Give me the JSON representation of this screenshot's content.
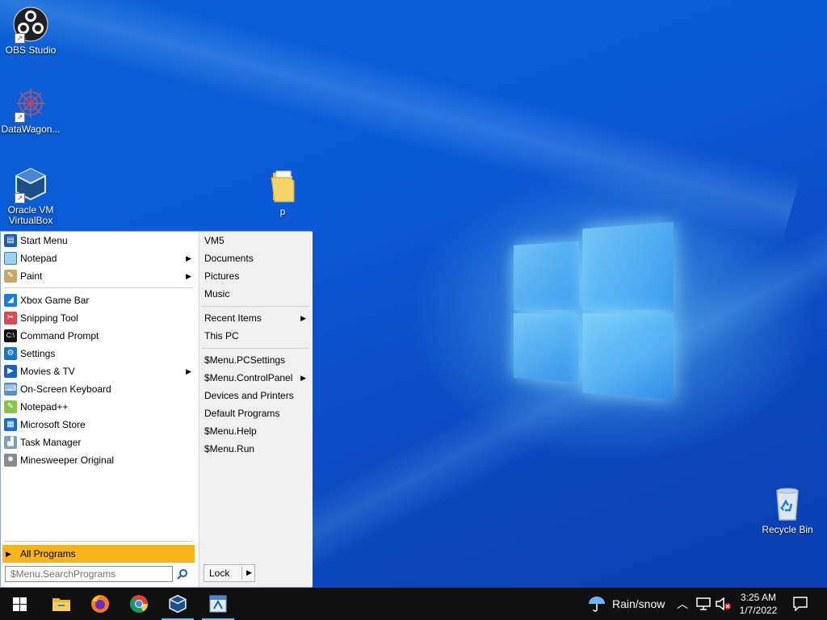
{
  "desktop": {
    "icons": [
      {
        "label": "OBS Studio"
      },
      {
        "label": "DataWagon..."
      },
      {
        "label": "Oracle VM VirtualBox"
      },
      {
        "label": "p"
      },
      {
        "label": "Recycle Bin"
      }
    ]
  },
  "start_menu": {
    "pinned": [
      {
        "label": "Start Menu",
        "icon": "start-menu-icon"
      },
      {
        "label": "Notepad",
        "icon": "notepad-icon",
        "has_submenu": true
      },
      {
        "label": "Paint",
        "icon": "paint-icon",
        "has_submenu": true
      }
    ],
    "recent": [
      {
        "label": "Xbox Game Bar",
        "icon": "xbox-icon"
      },
      {
        "label": "Snipping Tool",
        "icon": "scissors-icon"
      },
      {
        "label": "Command Prompt",
        "icon": "terminal-icon"
      },
      {
        "label": "Settings",
        "icon": "gear-icon"
      },
      {
        "label": "Movies & TV",
        "icon": "play-icon",
        "has_submenu": true
      },
      {
        "label": "On-Screen Keyboard",
        "icon": "keyboard-icon"
      },
      {
        "label": "Notepad++",
        "icon": "notepadpp-icon"
      },
      {
        "label": "Microsoft Store",
        "icon": "store-icon"
      },
      {
        "label": "Task Manager",
        "icon": "task-manager-icon"
      },
      {
        "label": "Minesweeper Original",
        "icon": "minesweeper-icon"
      }
    ],
    "all_programs": "All Programs",
    "search_placeholder": "$Menu.SearchPrograms",
    "right_groups": [
      [
        "VM5",
        "Documents",
        "Pictures",
        "Music"
      ],
      [
        "Recent Items",
        "This PC"
      ],
      [
        "$Menu.PCSettings",
        "$Menu.ControlPanel",
        "Devices and Printers",
        "Default Programs",
        "$Menu.Help",
        "$Menu.Run"
      ]
    ],
    "right_submenus": [
      "Recent Items",
      "$Menu.ControlPanel"
    ],
    "lock_label": "Lock"
  },
  "taskbar": {
    "weather": "Rain/snow",
    "time": "3:25 AM",
    "date": "1/7/2022"
  },
  "colors": {
    "all_programs_highlight": "#f7b41c",
    "taskbar_bg": "#101010",
    "active_indicator": "#76b9ed"
  }
}
